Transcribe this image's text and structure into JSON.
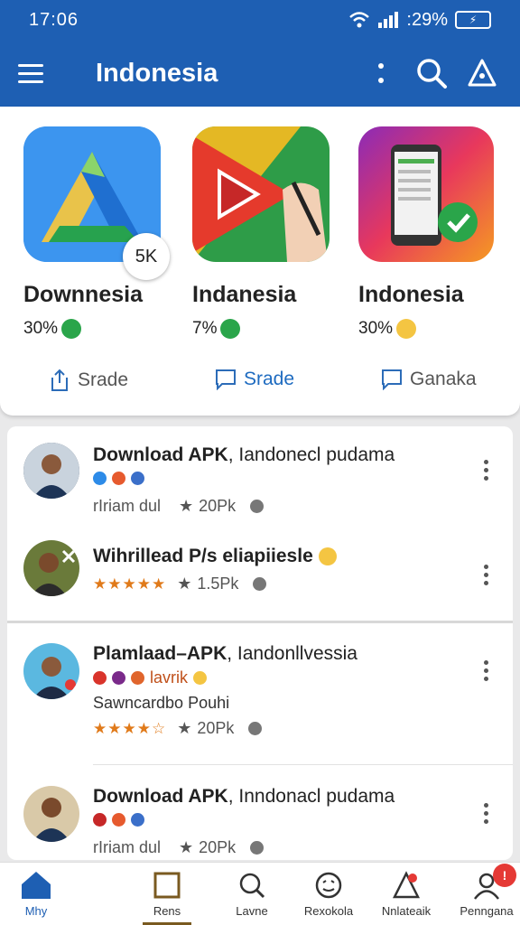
{
  "status_bar": {
    "time": "17:06",
    "battery": ":29%"
  },
  "app_bar": {
    "title": "Indonesia"
  },
  "featured": [
    {
      "name": "Downnesia",
      "stat": "30%",
      "action": "Srade",
      "badge": "5K"
    },
    {
      "name": "Indanesia",
      "stat": "7%",
      "action": "Srade"
    },
    {
      "name": "Indonesia",
      "stat": "30%",
      "action": "Ganaka"
    }
  ],
  "list": [
    {
      "title_bold": "Download APK",
      "title_rest": ", Iandonecl pudama",
      "meta": "rIriam dul",
      "count": "20Pk"
    },
    {
      "title_bold": "Wihrillead P/s eliapiiesle",
      "title_rest": "",
      "count": "1.5Pk"
    },
    {
      "title_bold": "Plamlaad–APK",
      "title_rest": ", Iandonllvessia",
      "tag": "lavrik",
      "subtitle": "Sawncardbo Pouhi",
      "count": "20Pk"
    },
    {
      "title_bold": "Download APK",
      "title_rest": ", Inndonacl pudama",
      "meta": "rIriam dul",
      "count": "20Pk"
    }
  ],
  "bottom_nav": [
    {
      "label": "Mhy"
    },
    {
      "label": "Rens"
    },
    {
      "label": "Lavne"
    },
    {
      "label": "Rexokola"
    },
    {
      "label": "Nnlateaik"
    },
    {
      "label": "Penngana"
    }
  ],
  "notification_badge": "!",
  "colors": {
    "brand": "#1e5fb3",
    "stars": "#e07a1a",
    "alert": "#e53935"
  }
}
